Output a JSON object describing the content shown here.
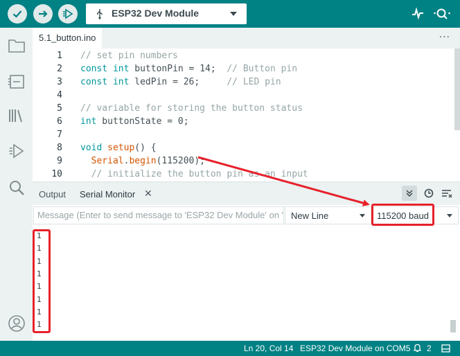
{
  "toolbar": {
    "verify_icon": "check-icon",
    "upload_icon": "arrow-right-icon",
    "debug_icon": "debug-play-icon",
    "board": {
      "usb_icon": "usb-icon",
      "name": "ESP32 Dev Module"
    },
    "serial_plotter_icon": "pulse-icon",
    "serial_monitor_icon": "magnifier-icon"
  },
  "sidebar": {
    "items": [
      {
        "icon": "folder-icon"
      },
      {
        "icon": "board-icon"
      },
      {
        "icon": "library-icon"
      },
      {
        "icon": "debug-icon"
      },
      {
        "icon": "search-icon"
      }
    ],
    "account_icon": "account-icon"
  },
  "tabs": {
    "active": "5.1_button.ino",
    "more": "···"
  },
  "editor": {
    "lines": [
      {
        "n": "1",
        "tokens": [
          {
            "t": "// set pin numbers",
            "c": "com"
          }
        ]
      },
      {
        "n": "2",
        "tokens": [
          {
            "t": "const",
            "c": "kw"
          },
          {
            "t": " ",
            "c": "txt"
          },
          {
            "t": "int",
            "c": "kw"
          },
          {
            "t": " buttonPin = 14;  ",
            "c": "txt"
          },
          {
            "t": "// Button pin",
            "c": "com"
          }
        ]
      },
      {
        "n": "3",
        "tokens": [
          {
            "t": "const",
            "c": "kw"
          },
          {
            "t": " ",
            "c": "txt"
          },
          {
            "t": "int",
            "c": "kw"
          },
          {
            "t": " ledPin = 26;     ",
            "c": "txt"
          },
          {
            "t": "// LED pin",
            "c": "com"
          }
        ]
      },
      {
        "n": "4",
        "tokens": []
      },
      {
        "n": "5",
        "tokens": [
          {
            "t": "// variable for storing the button status",
            "c": "com"
          }
        ]
      },
      {
        "n": "6",
        "tokens": [
          {
            "t": "int",
            "c": "kw"
          },
          {
            "t": " buttonState = 0;",
            "c": "txt"
          }
        ]
      },
      {
        "n": "7",
        "tokens": []
      },
      {
        "n": "8",
        "tokens": [
          {
            "t": "void",
            "c": "kw"
          },
          {
            "t": " ",
            "c": "txt"
          },
          {
            "t": "setup",
            "c": "fn"
          },
          {
            "t": "() {",
            "c": "txt"
          }
        ]
      },
      {
        "n": "9",
        "tokens": [
          {
            "t": "  ",
            "c": "txt"
          },
          {
            "t": "Serial",
            "c": "fn"
          },
          {
            "t": ".",
            "c": "txt"
          },
          {
            "t": "begin",
            "c": "fn"
          },
          {
            "t": "(115200);",
            "c": "txt"
          }
        ]
      },
      {
        "n": "10",
        "tokens": [
          {
            "t": "  // initialize the button pin as an input",
            "c": "com"
          }
        ]
      }
    ]
  },
  "panel": {
    "tab_output": "Output",
    "tab_serial_monitor": "Serial Monitor",
    "icons": [
      "double-chevron-down-icon",
      "clock-icon",
      "clear-lines-icon"
    ]
  },
  "serial_monitor": {
    "message_placeholder": "Message (Enter to send message to 'ESP32 Dev Module' on '",
    "line_ending": "New Line",
    "baud_rate": "115200 baud",
    "output_lines": [
      "1",
      "1",
      "1",
      "1",
      "1",
      "1",
      "1",
      "1"
    ]
  },
  "statusbar": {
    "position": "Ln 20, Col 14",
    "board_port": "ESP32 Dev Module on COM5",
    "notifications_icon": "bell-icon",
    "notifications_count": "2",
    "panel_icon": "panel-icon"
  },
  "colors": {
    "toolbar": "#008184",
    "sidebar": "#ecf1f1",
    "annotation": "#e6212a",
    "keyword": "#00979c",
    "function": "#d35400",
    "comment": "#95a5a6"
  }
}
